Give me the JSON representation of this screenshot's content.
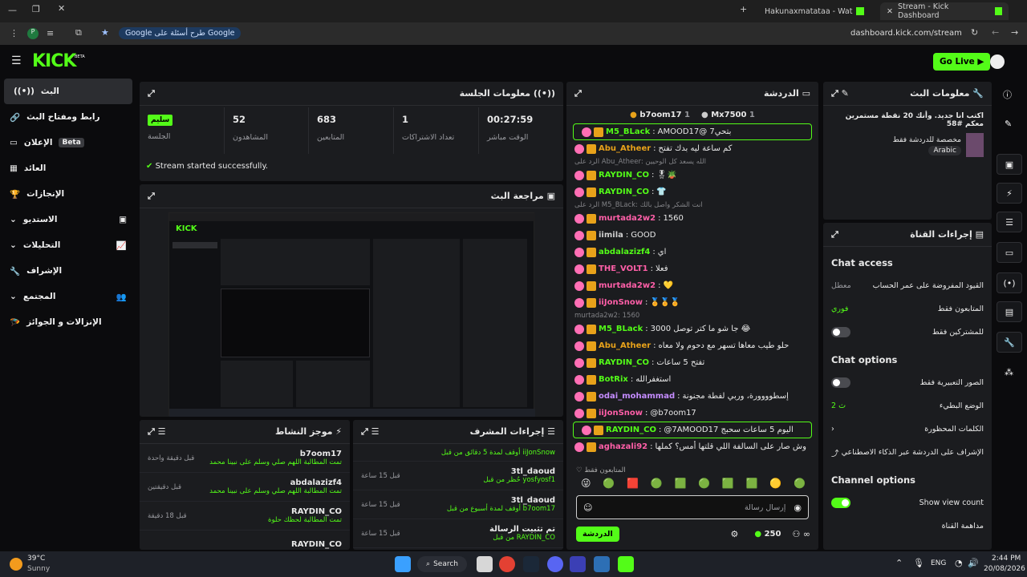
{
  "browser": {
    "tabs": [
      {
        "label": "Hakunaxmatataa - Watch the V"
      },
      {
        "label": "Stream - Kick Dashboard"
      }
    ],
    "search_chip": "طرح أسئلة على Google",
    "url": "dashboard.kick.com/stream"
  },
  "header": {
    "logo": "KICK",
    "logo_tag": "BETA",
    "go_live": "Go Live"
  },
  "sidebar": {
    "items": [
      {
        "label": "البث"
      },
      {
        "label": "رابط ومفتاح البث"
      },
      {
        "label": "الإعلان",
        "badge": "Beta"
      },
      {
        "label": "العائد"
      },
      {
        "label": "الإنجازات"
      },
      {
        "label": "الاستديو"
      },
      {
        "label": "التحليلات"
      },
      {
        "label": "الإشراف"
      },
      {
        "label": "المجتمع"
      },
      {
        "label": "الإنزالات و الجوائز"
      }
    ]
  },
  "session": {
    "title": "معلومات الجلسة",
    "status_badge": "سليم",
    "status_label": "الجلسة",
    "stats": [
      {
        "value": "52",
        "label": "المشاهدون"
      },
      {
        "value": "683",
        "label": "المتابعين"
      },
      {
        "value": "1",
        "label": "تعداد الاشتراكات"
      },
      {
        "value": "00:27:59",
        "label": "الوقت مباشر"
      }
    ],
    "success": "Stream started successfully."
  },
  "preview": {
    "title": "مراجعة البث"
  },
  "activity": {
    "title": "موجز النشاط",
    "items": [
      {
        "name": "b7oom17",
        "sub": "تمت المطالبة اللهم صلي وسلم على نبينا محمد",
        "time": "قبل دقيقة واحدة"
      },
      {
        "name": "abdalazizf4",
        "sub": "تمت المطالبة اللهم صلي وسلم على نبينا محمد",
        "time": "قبل دقيقتين"
      },
      {
        "name": "RAYDIN_CO",
        "sub": "تمت المطالبة لحظك حلوة",
        "time": "قبل 18 دقيقة"
      },
      {
        "name": "RAYDIN_CO",
        "sub": "",
        "time": ""
      }
    ]
  },
  "modlog": {
    "title": "إجراءات المشرف",
    "items": [
      {
        "name": "",
        "sub": "أوقف لمدة 5 دقائق من قبل iiJonSnow",
        "time": ""
      },
      {
        "name": "3tl_daoud",
        "sub": "حُظر من قبل yosfyosf1",
        "time": "قبل 15 ساعة"
      },
      {
        "name": "3tl_daoud",
        "sub": "أوقف لمدة أسبوع من قبل b7oom17",
        "time": "قبل 15 ساعة"
      },
      {
        "name": "تم تثبيت الرسالة",
        "sub": "من قبل RAYDIN_CO",
        "time": "قبل 15 ساعة"
      }
    ]
  },
  "chat": {
    "title": "الدردشة",
    "top": [
      {
        "name": "b7oom17",
        "count": "1"
      },
      {
        "name": "Mx7500",
        "count": "1"
      }
    ],
    "messages": [
      {
        "user": "M5_BLack",
        "color": "#53fc18",
        "text": "AMOOD17@ 7بتحي",
        "hl": true
      },
      {
        "user": "Abu_Atheer",
        "color": "#e8a21a",
        "text": "كم ساعة ليه بدك تفتح"
      },
      {
        "reply": "الرد على Abu_Atheer: الله يسعد كل الوحيين"
      },
      {
        "user": "RAYDIN_CO",
        "color": "#53fc18",
        "text": "🎖🪴"
      },
      {
        "user": "RAYDIN_CO",
        "color": "#53fc18",
        "text": "👕"
      },
      {
        "reply": "الرد على M5_BLack: انت الشكر واصل بالك"
      },
      {
        "user": "murtada2w2",
        "color": "#ff5fa8",
        "text": "1560"
      },
      {
        "user": "iimila",
        "color": "#cfcfcf",
        "text": "GOOD"
      },
      {
        "user": "abdalazizf4",
        "color": "#53fc18",
        "text": "اي"
      },
      {
        "user": "THE_VOLT1",
        "color": "#ff5fa8",
        "text": "فعلا"
      },
      {
        "user": "murtada2w2",
        "color": "#ff5fa8",
        "text": "💛"
      },
      {
        "user": "iiJonSnow",
        "color": "#ff5fa8",
        "text": "🏅🏅🏅"
      },
      {
        "reply": "murtada2w2: 1560"
      },
      {
        "user": "M5_BLack",
        "color": "#53fc18",
        "text": "3000 جا شو ما كتر توصل 😂"
      },
      {
        "user": "Abu_Atheer",
        "color": "#e8a21a",
        "text": "حلو طيب معاها تسهر مع دحوم ولا معاه"
      },
      {
        "user": "RAYDIN_CO",
        "color": "#53fc18",
        "text": "تفتح 5 ساعات"
      },
      {
        "user": "BotRix",
        "color": "#53fc18",
        "text": "استغفرالله"
      },
      {
        "user": "odai_mohammad",
        "color": "#c58cff",
        "text": "إسطوووورة، وربي لفطة مجنونة"
      },
      {
        "user": "iiJonSnow",
        "color": "#ff5fa8",
        "text": "@b7oom17"
      },
      {
        "user": "RAYDIN_CO",
        "color": "#53fc18",
        "text": "@7AMOOD17 اليوم 5 ساعات سحبج",
        "hl": true
      },
      {
        "user": "aghazali92",
        "color": "#ff5fa8",
        "text": "وش صار على السالفة اللي قلتها أمس؟ كملها"
      }
    ],
    "followers_only": "المتابعون فقط",
    "input_placeholder": "إرسال رسالة",
    "footer_count": "250",
    "send_label": "الدردشة"
  },
  "stream_info": {
    "title": "معلومات البث",
    "stream_title": "اكتب انا جديد. وأنك 20 نقطة مستمرين معكم #58",
    "category": "مخصصة للدردشة فقط",
    "language": "Arabic"
  },
  "channel_actions": {
    "title": "إجراءات القناة",
    "chat_access": "Chat access",
    "access_rows": [
      {
        "label": "القيود المفروضة على عمر الحساب",
        "value": "معطل"
      },
      {
        "label": "المتابعون فقط",
        "value": "فوري"
      },
      {
        "label": "للمشتركين فقط",
        "value": ""
      }
    ],
    "chat_options": "Chat options",
    "option_rows": [
      {
        "label": "الصور التعبيرية فقط",
        "value": ""
      },
      {
        "label": "الوضع البطيء",
        "value": "2 ث"
      },
      {
        "label": "الكلمات المحظورة",
        "value": ""
      },
      {
        "label": "الإشراف على الدردشة عبر الذكاء الاصطناعي",
        "value": ""
      }
    ],
    "channel_options": "Channel options",
    "show_view_count": "Show view count",
    "raid": "مداهمة القناة"
  },
  "taskbar": {
    "weather_temp": "39°C",
    "weather_desc": "Sunny",
    "search": "Search",
    "lang": "ENG",
    "time": "2:44 PM",
    "date": "20/08/2026"
  },
  "colors": {
    "accent": "#53fc18",
    "panel": "#1b1c1f",
    "bg": "#0b0b0d"
  }
}
